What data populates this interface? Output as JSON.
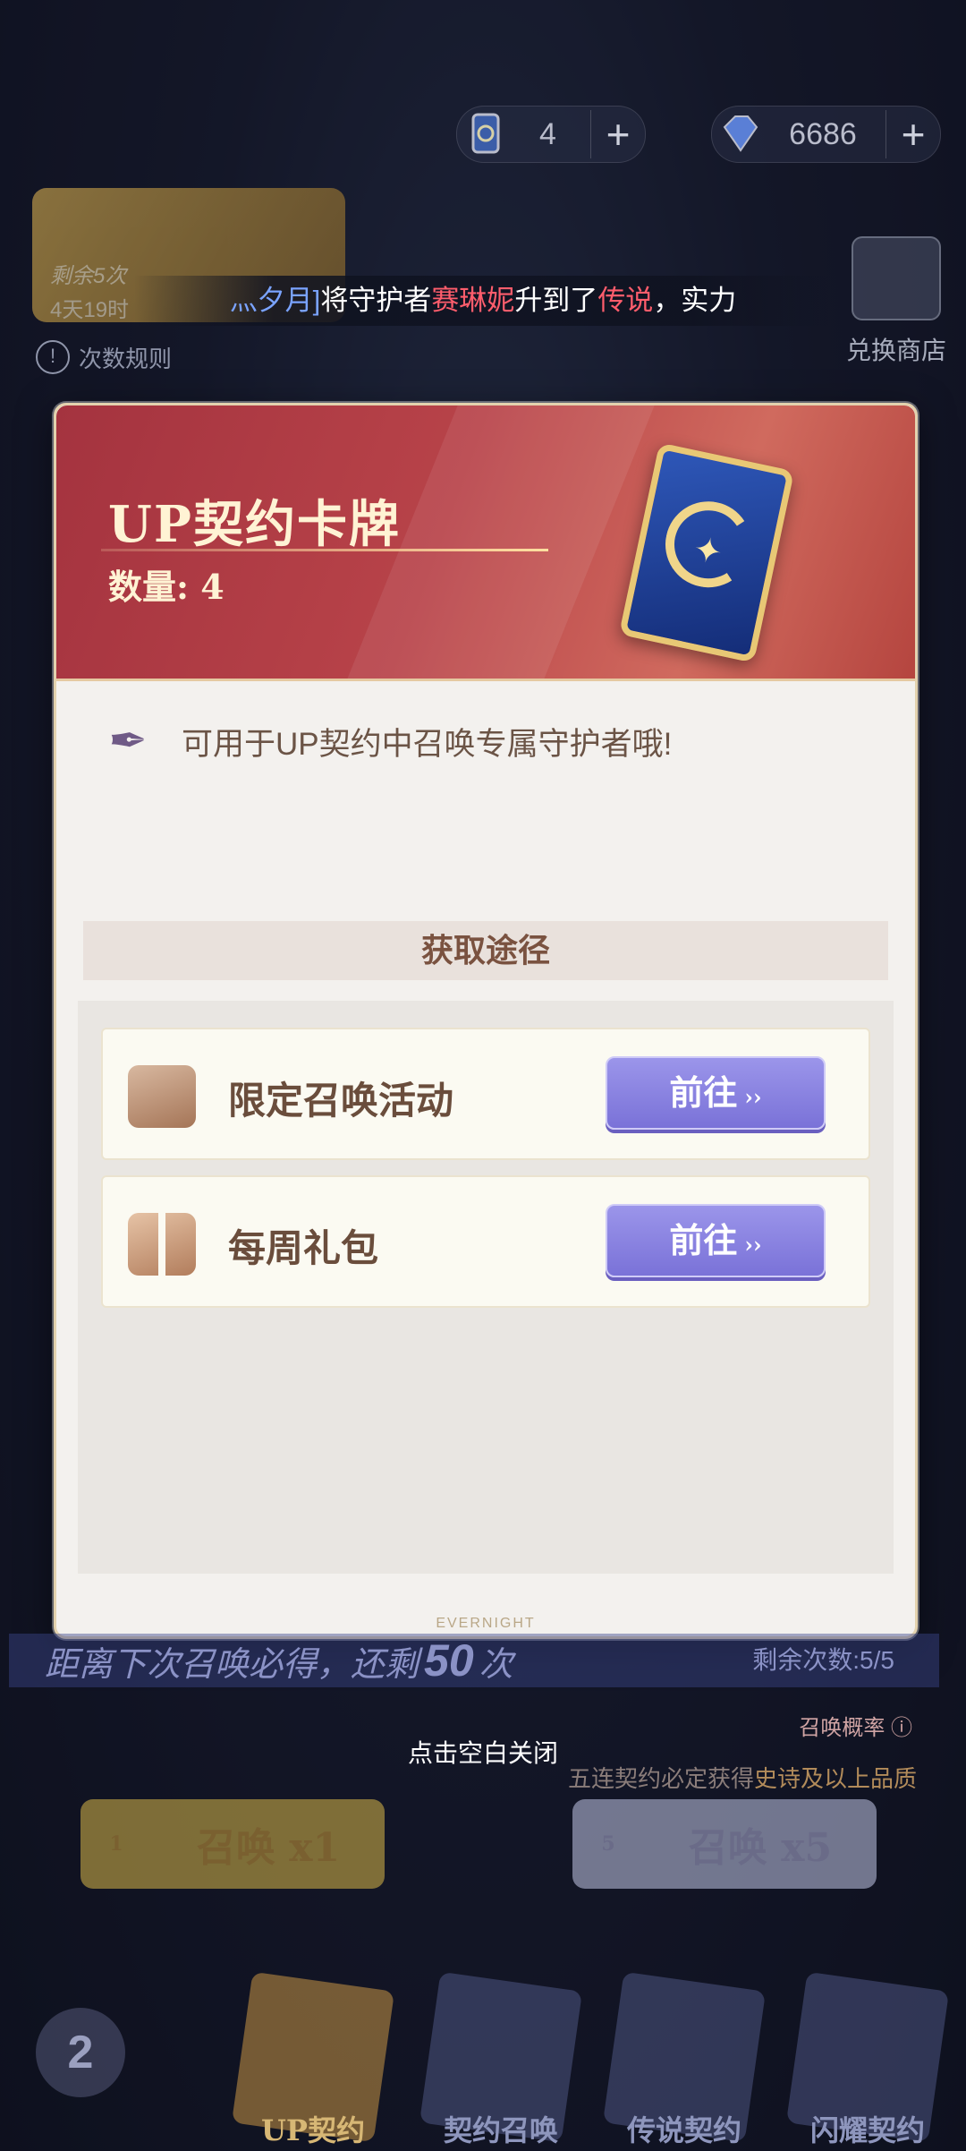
{
  "resources": [
    {
      "icon": "summon-card-icon",
      "value": "4",
      "plus": "+"
    },
    {
      "icon": "diamond-icon",
      "value": "6686",
      "plus": "+"
    }
  ],
  "event": {
    "remaining": "剩余5次",
    "timer": "4天19时"
  },
  "rules_link": "次数规则",
  "shop_label": "兑换商店",
  "marquee": {
    "name": "灬夕月]",
    "t1": "将守护者",
    "hero": "赛琳妮",
    "t2": "升到了",
    "rank": "传说",
    "t3": "，实力"
  },
  "modal": {
    "title": "UP契约卡牌",
    "count": "数量: 4",
    "description": "可用于UP契约中召唤专属守护者哦!",
    "section_title": "获取途径",
    "sources": [
      {
        "label": "限定召唤活动",
        "button": "前往",
        "arrows": "››"
      },
      {
        "label": "每周礼包",
        "button": "前往",
        "arrows": "››"
      }
    ],
    "footer_mark": "EVERNIGHT"
  },
  "progress": {
    "prefix": "距离下次召唤必得，还剩",
    "number": "50",
    "suffix": "次",
    "remaining": "剩余次数:5/5"
  },
  "close_hint": "点击空白关闭",
  "rate_label": "召唤概率",
  "guarantee_note": {
    "a": "五连契约必定获得",
    "b": "史诗及以上品质"
  },
  "pulls": [
    {
      "cost": "1",
      "label": "召唤 x1"
    },
    {
      "cost": "5",
      "label": "召唤 x5"
    }
  ],
  "nav": [
    "UP契约",
    "契约召唤",
    "传说契约",
    "闪耀契约"
  ],
  "back_label": "2"
}
